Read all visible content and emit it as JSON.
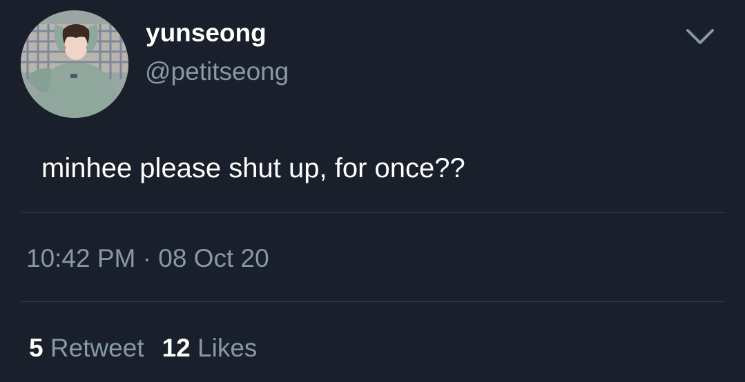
{
  "tweet": {
    "author": {
      "display_name": "yunseong",
      "handle": "@petitseong",
      "avatar_icon": "profile-photo"
    },
    "text": "minhee please shut up, for once??",
    "timestamp": "10:42 PM · 08 Oct 20",
    "stats": {
      "retweets_count": "5",
      "retweets_label": "Retweet",
      "likes_count": "12",
      "likes_label": "Likes"
    },
    "menu_icon": "chevron-down-icon"
  },
  "colors": {
    "background": "#19202b",
    "primary_text": "#ffffff",
    "secondary_text": "#8798a6",
    "divider": "#323c4a"
  }
}
